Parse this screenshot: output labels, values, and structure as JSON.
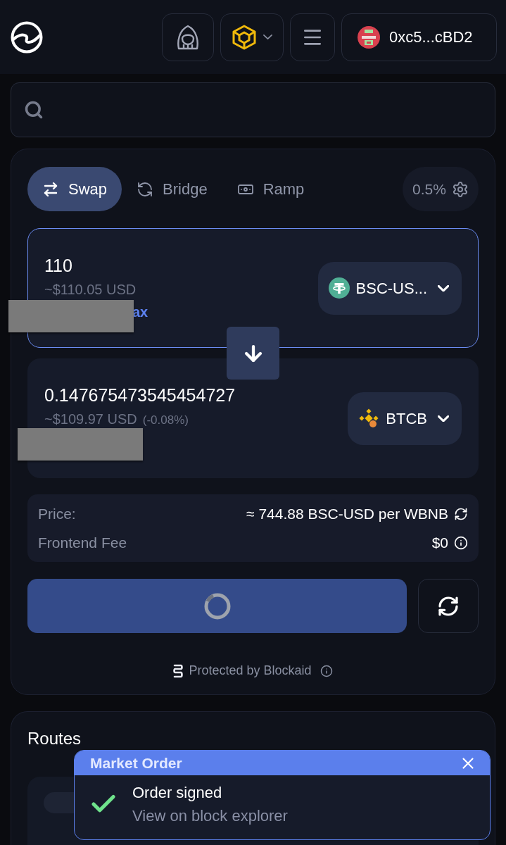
{
  "header": {
    "wallet": {
      "address": "0xc5...cBD2"
    }
  },
  "swap_card": {
    "tabs": [
      {
        "label": "Swap",
        "selected": true
      },
      {
        "label": "Bridge",
        "selected": false
      },
      {
        "label": "Ramp",
        "selected": false
      }
    ],
    "slippage": "0.5%",
    "from": {
      "amount": "110",
      "usd_value": "~$110.05 USD",
      "link": "ax",
      "token": "BSC-US...",
      "focused": true
    },
    "to": {
      "amount": "0.147675473545454727",
      "usd_value": "~$109.97 USD",
      "change": "(-0.08%)",
      "token": "BTCB",
      "focused": false
    },
    "details": [
      {
        "kind": "price",
        "label": "Price:",
        "value": "≈ 744.88 BSC-USD per WBNB"
      },
      {
        "kind": "fee",
        "label": "Frontend Fee",
        "value": "$0"
      }
    ],
    "submit": {
      "loading": true
    },
    "security_note": "Protected by Blockaid"
  },
  "routes": {
    "title": "Routes"
  },
  "toast": {
    "title": "Market Order",
    "message": "Order signed",
    "link": "View on block explorer"
  }
}
